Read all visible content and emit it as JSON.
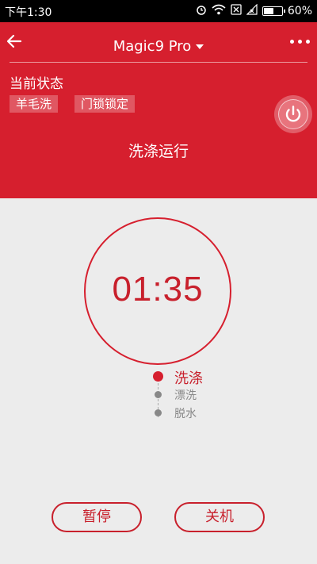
{
  "status_bar": {
    "time": "下午1:30",
    "battery_percent": "60%",
    "battery_level": 0.6
  },
  "header": {
    "title": "Magic9 Pro",
    "state_label": "当前状态",
    "tags": [
      "羊毛洗",
      "门锁锁定"
    ],
    "run_status": "洗涤运行"
  },
  "timer": {
    "remaining": "01:35"
  },
  "steps": [
    {
      "label": "洗涤",
      "active": true
    },
    {
      "label": "漂洗",
      "active": false
    },
    {
      "label": "脱水",
      "active": false
    }
  ],
  "buttons": {
    "pause": "暂停",
    "power_off": "关机"
  },
  "colors": {
    "accent": "#d61f2e",
    "text_red": "#c8202c",
    "inactive": "#888888",
    "background": "#ececec"
  }
}
